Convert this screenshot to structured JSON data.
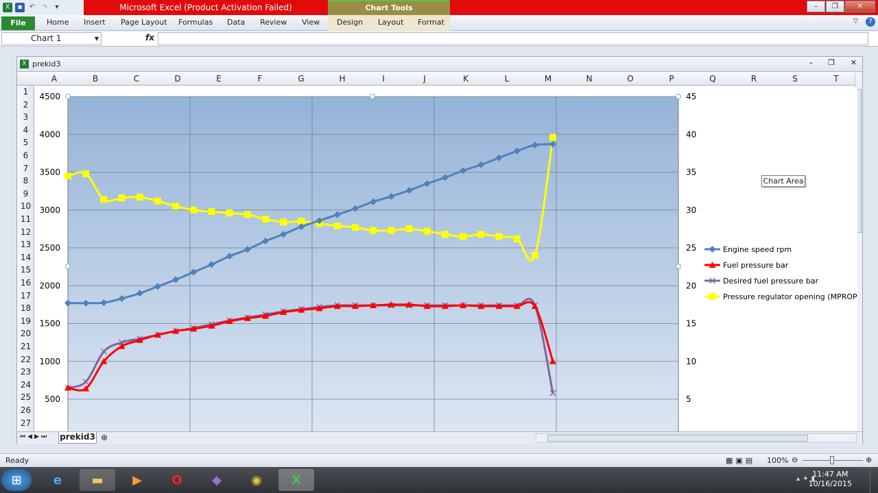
{
  "window": {
    "title": "Microsoft Excel (Product Activation Failed)",
    "context_group": "Chart Tools"
  },
  "ribbon": {
    "file_label": "File",
    "tabs": [
      "Home",
      "Insert",
      "Page Layout",
      "Formulas",
      "Data",
      "Review",
      "View"
    ],
    "context_tabs": [
      "Design",
      "Layout",
      "Format"
    ]
  },
  "formula_bar": {
    "name_box": "Chart 1",
    "fx_label": "fx",
    "formula": ""
  },
  "workbook": {
    "name": "prekid3",
    "sheet_tab": "prekid3"
  },
  "grid": {
    "columns": [
      "A",
      "B",
      "C",
      "D",
      "E",
      "F",
      "G",
      "H",
      "I",
      "J",
      "K",
      "L",
      "M",
      "N",
      "O",
      "P",
      "Q",
      "R",
      "S",
      "T"
    ],
    "rows": [
      "1",
      "2",
      "3",
      "4",
      "5",
      "6",
      "7",
      "8",
      "9",
      "10",
      "11",
      "12",
      "13",
      "14",
      "15",
      "16",
      "17",
      "18",
      "19",
      "20",
      "21",
      "22",
      "23",
      "24",
      "25",
      "26",
      "27"
    ]
  },
  "tooltip": {
    "text": "Chart Area"
  },
  "status": {
    "ready": "Ready",
    "zoom": "100%"
  },
  "clock": {
    "time": "11:47 AM",
    "date": "10/16/2015"
  },
  "chart_data": {
    "type": "line",
    "title": "",
    "ylim_left": [
      500,
      4500
    ],
    "yticks_left": [
      500,
      1000,
      1500,
      2000,
      2500,
      3000,
      3500,
      4000,
      4500
    ],
    "ylim_right": [
      5,
      45
    ],
    "yticks_right": [
      5,
      10,
      15,
      20,
      25,
      30,
      35,
      40,
      45
    ],
    "grid": true,
    "legend_position": "right",
    "series": [
      {
        "name": "Engine speed rpm",
        "axis": "left",
        "color": "#4f81bd",
        "marker": "diamond",
        "values": [
          1770,
          1770,
          1775,
          1830,
          1900,
          1990,
          2080,
          2180,
          2280,
          2390,
          2480,
          2590,
          2680,
          2780,
          2860,
          2940,
          3020,
          3110,
          3180,
          3260,
          3350,
          3430,
          3520,
          3600,
          3690,
          3780,
          3860,
          3870
        ]
      },
      {
        "name": "Fuel pressure bar",
        "axis": "right",
        "color": "#ff0000",
        "marker": "triangle",
        "values": [
          6.5,
          6.4,
          10,
          12,
          12.8,
          13.5,
          14,
          14.3,
          14.7,
          15.3,
          15.7,
          16,
          16.5,
          16.8,
          17,
          17.3,
          17.3,
          17.4,
          17.5,
          17.5,
          17.3,
          17.3,
          17.4,
          17.3,
          17.3,
          17.3,
          17.3,
          10
        ]
      },
      {
        "name": "Desired fuel pressure bar",
        "axis": "right",
        "color": "#8064a2",
        "marker": "x",
        "values": [
          6.5,
          7.3,
          11.3,
          12.5,
          13,
          13.5,
          14,
          14.4,
          14.9,
          15.4,
          15.8,
          16.2,
          16.6,
          16.9,
          17.2,
          17.4,
          17.4,
          17.4,
          17.4,
          17.4,
          17.4,
          17.4,
          17.4,
          17.4,
          17.4,
          17.4,
          17.4,
          5.8
        ]
      },
      {
        "name": "Pressure regulator opening (MPROP) %",
        "axis": "right",
        "color": "#ffff00",
        "marker": "square",
        "values": [
          34.5,
          34.8,
          31.4,
          31.6,
          31.7,
          31.2,
          30.5,
          30,
          29.8,
          29.6,
          29.4,
          28.8,
          28.4,
          28.5,
          28.2,
          27.9,
          27.7,
          27.3,
          27.3,
          27.5,
          27.2,
          26.8,
          26.5,
          26.8,
          26.5,
          26.2,
          24,
          39.6
        ]
      }
    ]
  }
}
